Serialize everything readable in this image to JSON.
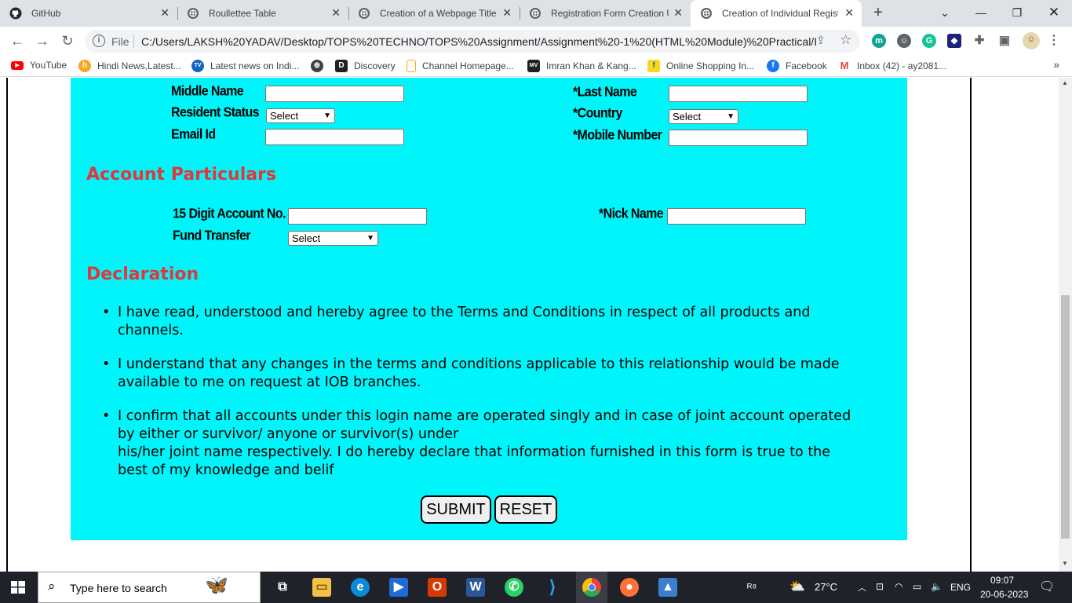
{
  "browser": {
    "tabs": [
      {
        "title": "GitHub",
        "icon": "github-icon"
      },
      {
        "title": "Roullettee Table",
        "icon": "globe-icon"
      },
      {
        "title": "Creation of a Webpage Title",
        "icon": "globe-icon"
      },
      {
        "title": "Registration Form Creation U",
        "icon": "globe-icon"
      },
      {
        "title": "Creation of Individual Registr",
        "icon": "globe-icon",
        "active": true
      }
    ],
    "new_tab": "+",
    "address": {
      "scheme": "File",
      "url": "C:/Users/LAKSH%20YADAV/Desktop/TOPS%20TECHNO/TOPS%20Assignment/Assignment%20-1%20(HTML%20Module)%20Practical/In..."
    },
    "bookmarks": [
      {
        "label": "YouTube"
      },
      {
        "label": "Hindi News,Latest..."
      },
      {
        "label": "Latest news on Indi..."
      },
      {
        "label": "Discovery"
      },
      {
        "label": "Channel Homepage..."
      },
      {
        "label": "Imran Khan & Kang..."
      },
      {
        "label": "Online Shopping In..."
      },
      {
        "label": "Facebook"
      },
      {
        "label": "Inbox (42) - ay2081..."
      }
    ]
  },
  "form": {
    "personal": {
      "middle_name_label": "Middle Name",
      "last_name_label": "*Last Name",
      "resident_status_label": "Resident Status",
      "resident_status_value": "Select",
      "country_label": "*Country",
      "country_value": "Select",
      "email_label": "Email Id",
      "mobile_label": "*Mobile Number"
    },
    "account_heading": "Account Particulars",
    "account": {
      "account_no_label": "15 Digit Account No.",
      "nick_name_label": "*Nick Name",
      "fund_transfer_label": "Fund Transfer",
      "fund_transfer_value": "Select"
    },
    "declaration_heading": "Declaration",
    "declarations": [
      {
        "line1": "I have read, understood and hereby agree to the Terms and Conditions in respect of all products and",
        "line2": "channels."
      },
      {
        "line1": "I understand that any changes in the terms and conditions applicable to this relationship would be made",
        "line2": "available to me on request at IOB branches."
      },
      {
        "line1": "I confirm that all accounts under this login name are operated singly and in case of joint account operated",
        "line2": "by either or survivor/ anyone or survivor(s) under",
        "line3": "his/her joint name respectively. I do hereby declare that information furnished in this form is true to the",
        "line4": "best of my knowledge and belif"
      }
    ],
    "submit_label": "SUBMIT",
    "reset_label": "RESET"
  },
  "taskbar": {
    "search_placeholder": "Type here to search",
    "weather": "27°C",
    "language": "ENG",
    "time": "09:07",
    "date": "20-06-2023"
  },
  "colors": {
    "form_bg": "#00f5fa",
    "heading": "#e0373b"
  }
}
